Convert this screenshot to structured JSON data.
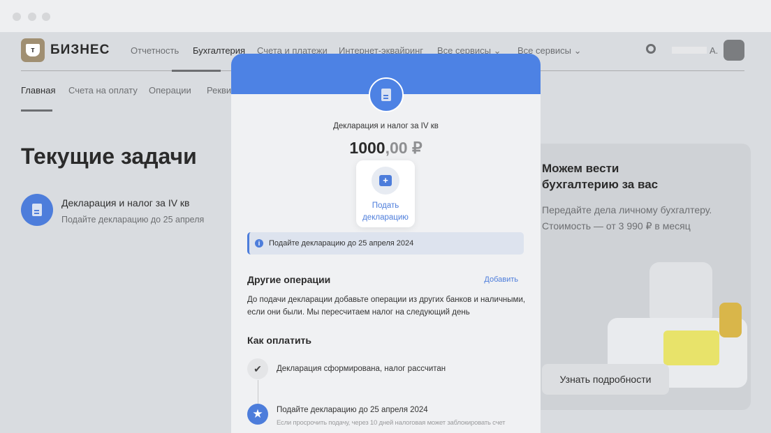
{
  "header": {
    "brand": "БИЗНЕС",
    "logo_letter": "т",
    "nav": [
      "Отчетность",
      "Бухгалтерия",
      "Счета и платежи",
      "Интернет-эквайринг",
      "Все сервисы",
      "Все сервисы"
    ],
    "user": "А."
  },
  "subnav": [
    "Главная",
    "Счета на оплату",
    "Операции",
    "Рекви"
  ],
  "main": {
    "title": "Текущие задачи",
    "task": {
      "title": "Декларация и налог за IV кв",
      "subtitle": "Подайте декларацию до 25 апреля"
    }
  },
  "promo": {
    "title": "Можем вести бухгалтерию за вас",
    "text": "Передайте дела личному бухгалтеру. Стоимость — от 3 990 ₽ в месяц",
    "button": "Узнать подробности"
  },
  "modal": {
    "title": "Декларация и налог за IV кв",
    "amount_int": "1000",
    "amount_dec": ",00 ₽",
    "action": "Подать декларацию",
    "info": "Подайте декларацию до 25 апреля 2024",
    "other": {
      "title": "Другие операции",
      "add": "Добавить",
      "text": "До подачи декларации добавьте операции из других банков и наличными, если они были. Мы пересчитаем налог на следующий день"
    },
    "pay": {
      "title": "Как оплатить",
      "steps": [
        {
          "title": "Декларация сформирована, налог рассчитан"
        },
        {
          "title": "Подайте декларацию до 25 апреля 2024",
          "subtitle": "Если просрочить подачу, через 10 дней налоговая может заблокировать счет"
        }
      ]
    }
  },
  "colors": {
    "accent": "#4d82e4"
  }
}
